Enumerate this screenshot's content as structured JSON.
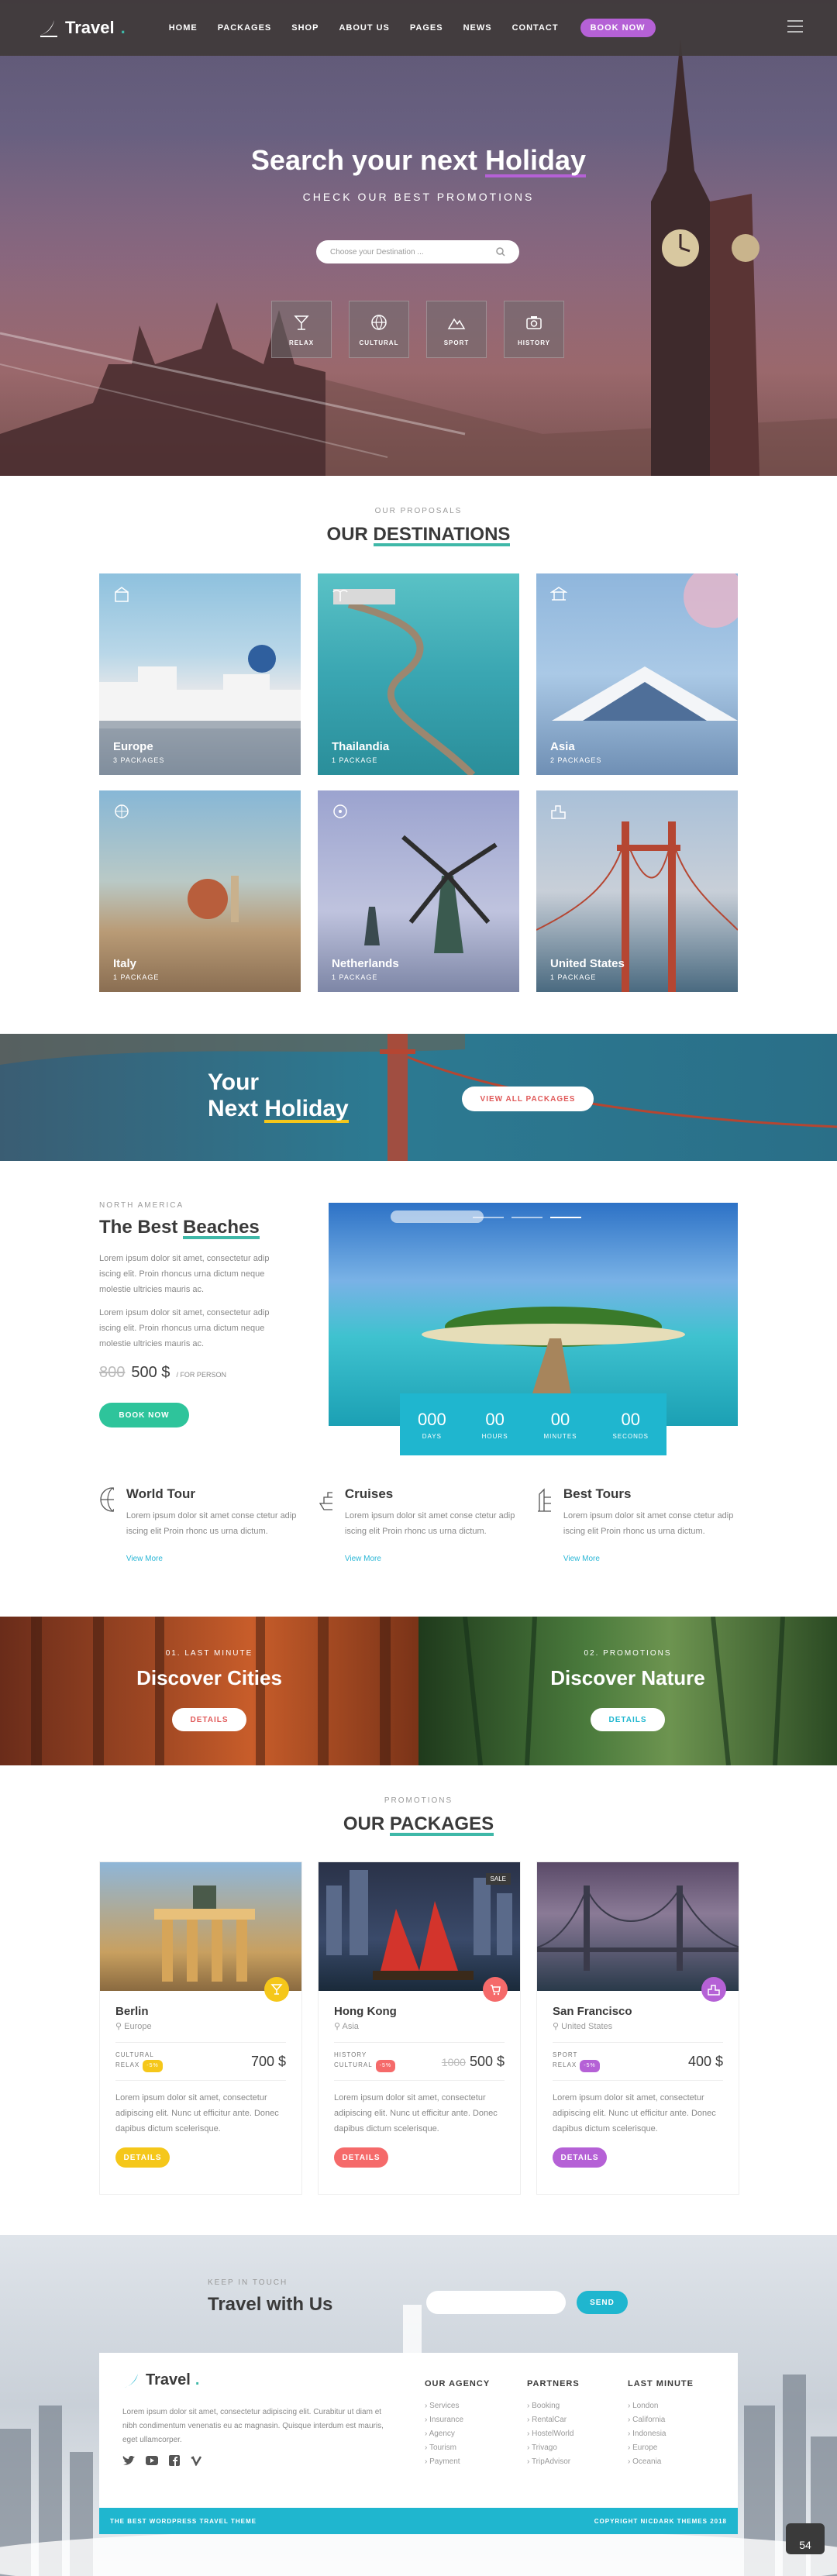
{
  "nav": {
    "logo": "Travel",
    "items": [
      "HOME",
      "PACKAGES",
      "SHOP",
      "ABOUT US",
      "PAGES",
      "NEWS",
      "CONTACT"
    ],
    "cta": "BOOK NOW"
  },
  "hero": {
    "title_pre": "Search your next ",
    "title_em": "Holiday",
    "subtitle": "CHECK OUR BEST PROMOTIONS",
    "search_placeholder": "Choose your Destination ...",
    "categories": [
      "RELAX",
      "CULTURAL",
      "SPORT",
      "HISTORY"
    ]
  },
  "destinations": {
    "kicker": "OUR PROPOSALS",
    "title_pre": "OUR ",
    "title_em": "DESTINATIONS",
    "cards": [
      {
        "name": "Europe",
        "count": "3 PACKAGES"
      },
      {
        "name": "Thailandia",
        "count": "1 PACKAGE"
      },
      {
        "name": "Asia",
        "count": "2 PACKAGES"
      },
      {
        "name": "Italy",
        "count": "1 PACKAGE"
      },
      {
        "name": "Netherlands",
        "count": "1 PACKAGE"
      },
      {
        "name": "United States",
        "count": "1 PACKAGE"
      }
    ]
  },
  "banner": {
    "line1": "Your",
    "line2_pre": "Next ",
    "line2_em": "Holiday",
    "button": "VIEW ALL PACKAGES"
  },
  "beaches": {
    "kicker": "NORTH AMERICA",
    "title_pre": "The Best ",
    "title_em": "Beaches",
    "para1": "Lorem ipsum dolor sit amet, consectetur adip iscing elit. Proin rhoncus urna dictum neque molestie ultricies mauris ac.",
    "para2": "Lorem ipsum dolor sit amet, consectetur adip iscing elit. Proin rhoncus urna dictum neque molestie ultricies mauris ac.",
    "old_price": "800",
    "price": "500 $",
    "per": "/ FOR PERSON",
    "button": "BOOK NOW",
    "countdown": [
      {
        "value": "000",
        "label": "DAYS"
      },
      {
        "value": "00",
        "label": "HOURS"
      },
      {
        "value": "00",
        "label": "MINUTES"
      },
      {
        "value": "00",
        "label": "SECONDS"
      }
    ]
  },
  "features": [
    {
      "title": "World Tour",
      "text": "Lorem ipsum dolor sit amet conse ctetur adip iscing elit Proin rhonc us urna dictum.",
      "link": "View More"
    },
    {
      "title": "Cruises",
      "text": "Lorem ipsum dolor sit amet conse ctetur adip iscing elit Proin rhonc us urna dictum.",
      "link": "View More"
    },
    {
      "title": "Best Tours",
      "text": "Lorem ipsum dolor sit amet conse ctetur adip iscing elit Proin rhonc us urna dictum.",
      "link": "View More"
    }
  ],
  "discover": [
    {
      "kicker": "01. LAST MINUTE",
      "title": "Discover Cities",
      "button": "DETAILS"
    },
    {
      "kicker": "02. PROMOTIONS",
      "title": "Discover Nature",
      "button": "DETAILS"
    }
  ],
  "packages": {
    "kicker": "PROMOTIONS",
    "title_pre": "OUR ",
    "title_em": "PACKAGES",
    "items": [
      {
        "city": "Berlin",
        "place": "Europe",
        "cat1": "CULTURAL",
        "cat2": "RELAX",
        "tag": "-5%",
        "old": "",
        "price": "700 $",
        "text": "Lorem ipsum dolor sit amet, consectetur adipiscing elit. Nunc ut efficitur ante. Donec dapibus dictum scelerisque.",
        "button": "DETAILS",
        "color": "#f5c71a"
      },
      {
        "city": "Hong Kong",
        "place": "Asia",
        "cat1": "HISTORY",
        "cat2": "CULTURAL",
        "tag": "-5%",
        "old": "1000",
        "price": "500 $",
        "text": "Lorem ipsum dolor sit amet, consectetur adipiscing elit. Nunc ut efficitur ante. Donec dapibus dictum scelerisque.",
        "button": "DETAILS",
        "color": "#f56a6a",
        "sale": "SALE"
      },
      {
        "city": "San Francisco",
        "place": "United States",
        "cat1": "SPORT",
        "cat2": "RELAX",
        "tag": "-5%",
        "old": "",
        "price": "400 $",
        "text": "Lorem ipsum dolor sit amet, consectetur adipiscing elit. Nunc ut efficitur ante. Donec dapibus dictum scelerisque.",
        "button": "DETAILS",
        "color": "#b561d6"
      }
    ]
  },
  "newsletter": {
    "kicker": "KEEP IN TOUCH",
    "title": "Travel with Us",
    "button": "SEND"
  },
  "footer": {
    "logo": "Travel",
    "text": "Lorem ipsum dolor sit amet, consectetur adipiscing elit. Curabitur ut diam et nibh condimentum venenatis eu ac magnasin. Quisque interdum est mauris, eget ullamcorper.",
    "cols": [
      {
        "title": "OUR AGENCY",
        "items": [
          "Services",
          "Insurance",
          "Agency",
          "Tourism",
          "Payment"
        ]
      },
      {
        "title": "PARTNERS",
        "items": [
          "Booking",
          "RentalCar",
          "HostelWorld",
          "Trivago",
          "TripAdvisor"
        ]
      },
      {
        "title": "LAST MINUTE",
        "items": [
          "London",
          "California",
          "Indonesia",
          "Europe",
          "Oceania"
        ]
      }
    ],
    "bottom_left": "THE BEST WORDPRESS TRAVEL THEME",
    "bottom_right": "COPYRIGHT NICDARK THEMES 2018",
    "speed": "54"
  },
  "colors": {
    "accent": "#3fb8a8",
    "purple": "#b561d6",
    "blue": "#29b6d6",
    "green": "#2ec49b"
  }
}
